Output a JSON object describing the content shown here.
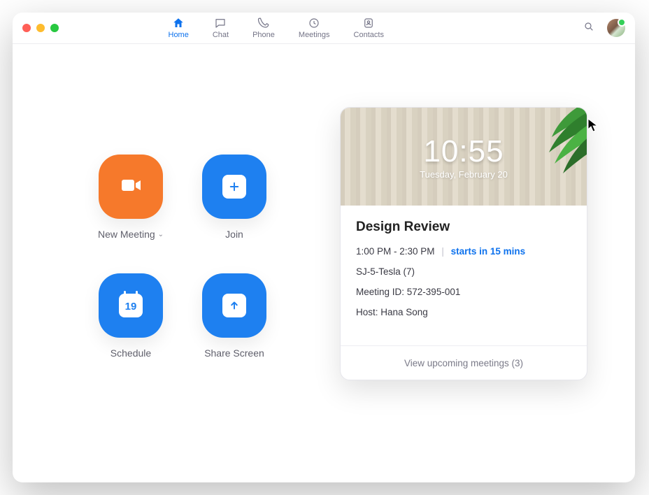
{
  "nav": {
    "tabs": [
      {
        "id": "home",
        "label": "Home",
        "active": true
      },
      {
        "id": "chat",
        "label": "Chat"
      },
      {
        "id": "phone",
        "label": "Phone"
      },
      {
        "id": "meetings",
        "label": "Meetings"
      },
      {
        "id": "contacts",
        "label": "Contacts"
      }
    ]
  },
  "actions": {
    "new_meeting": {
      "label": "New Meeting"
    },
    "join": {
      "label": "Join"
    },
    "schedule": {
      "label": "Schedule",
      "day": "19"
    },
    "share_screen": {
      "label": "Share Screen"
    }
  },
  "card": {
    "time": "10:55",
    "date": "Tuesday, February 20",
    "meeting_title": "Design Review",
    "time_range": "1:00 PM - 2:30 PM",
    "separator": "|",
    "starts_in": "starts in 15 mins",
    "room": "SJ-5-Tesla (7)",
    "meeting_id_line": "Meeting ID: 572-395-001",
    "host_line": "Host: Hana Song",
    "footer": "View upcoming meetings (3)"
  }
}
